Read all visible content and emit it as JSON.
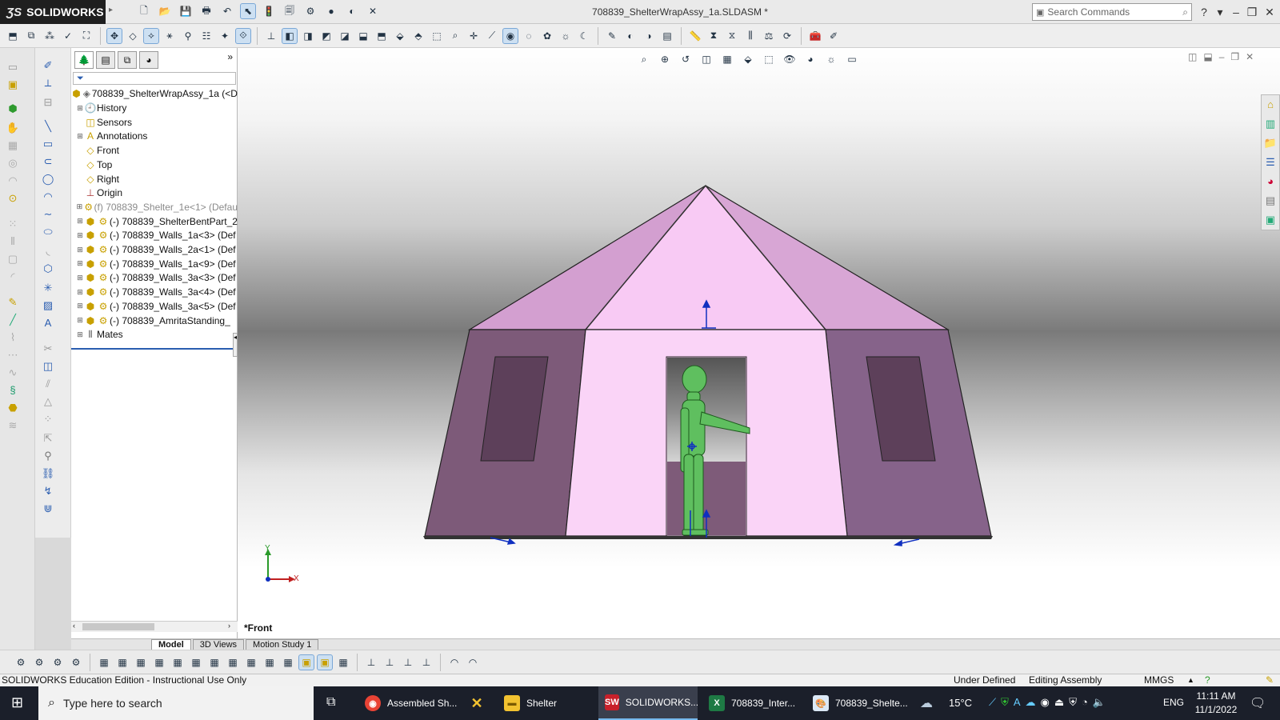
{
  "app": {
    "brand": "SOLIDWORKS",
    "title": "708839_ShelterWrapAssy_1a.SLDASM *",
    "search_placeholder": "Search Commands"
  },
  "tree": {
    "root": "708839_ShelterWrapAssy_1a  (<D",
    "items": [
      {
        "label": "History",
        "icon": "history-icon"
      },
      {
        "label": "Sensors",
        "icon": "sensor-icon"
      },
      {
        "label": "Annotations",
        "icon": "annotations-icon"
      },
      {
        "label": "Front",
        "icon": "plane-icon"
      },
      {
        "label": "Top",
        "icon": "plane-icon"
      },
      {
        "label": "Right",
        "icon": "plane-icon"
      },
      {
        "label": "Origin",
        "icon": "origin-icon"
      },
      {
        "label": "(f) 708839_Shelter_1e<1> (Defau",
        "icon": "part-icon"
      },
      {
        "label": "(-) 708839_ShelterBentPart_2",
        "icon": "part-icon"
      },
      {
        "label": "(-) 708839_Walls_1a<3> (Def",
        "icon": "part-icon"
      },
      {
        "label": "(-) 708839_Walls_2a<1> (Def",
        "icon": "part-icon"
      },
      {
        "label": "(-) 708839_Walls_1a<9> (Def",
        "icon": "part-icon"
      },
      {
        "label": "(-) 708839_Walls_3a<3> (Def",
        "icon": "part-icon"
      },
      {
        "label": "(-) 708839_Walls_3a<4> (Def",
        "icon": "part-icon"
      },
      {
        "label": "(-) 708839_Walls_3a<5> (Def",
        "icon": "part-icon"
      },
      {
        "label": "(-) 708839_AmritaStanding_",
        "icon": "part-icon"
      },
      {
        "label": "Mates",
        "icon": "mates-icon"
      }
    ]
  },
  "viewport": {
    "view_label": "*Front",
    "axis_x": "X",
    "axis_y": "Y"
  },
  "tabs": [
    "Model",
    "3D Views",
    "Motion Study 1"
  ],
  "status": {
    "edition": "SOLIDWORKS Education Edition - Instructional Use Only",
    "definition": "Under Defined",
    "mode": "Editing Assembly",
    "units": "MMGS"
  },
  "taskbar": {
    "search_placeholder": "Type here to search",
    "apps": [
      {
        "label": "Assembled Sh...",
        "icon": "chrome-icon"
      },
      {
        "label": "Shelter",
        "icon": "folder-icon"
      },
      {
        "label": "SOLIDWORKS...",
        "icon": "solidworks-icon"
      },
      {
        "label": "708839_Inter...",
        "icon": "excel-icon"
      },
      {
        "label": "708839_Shelte...",
        "icon": "paint-icon"
      }
    ],
    "temperature": "15°C",
    "language": "ENG",
    "time": "11:11 AM",
    "date": "11/1/2022"
  },
  "colors": {
    "tent_roof_light": "#f7c7f3",
    "tent_roof_dark": "#cf9ccd",
    "tent_wall_dark": "#7b5878",
    "tent_wall_light": "#f8d2f6",
    "window": "#5b3f58",
    "figure": "#5fbf5f"
  }
}
